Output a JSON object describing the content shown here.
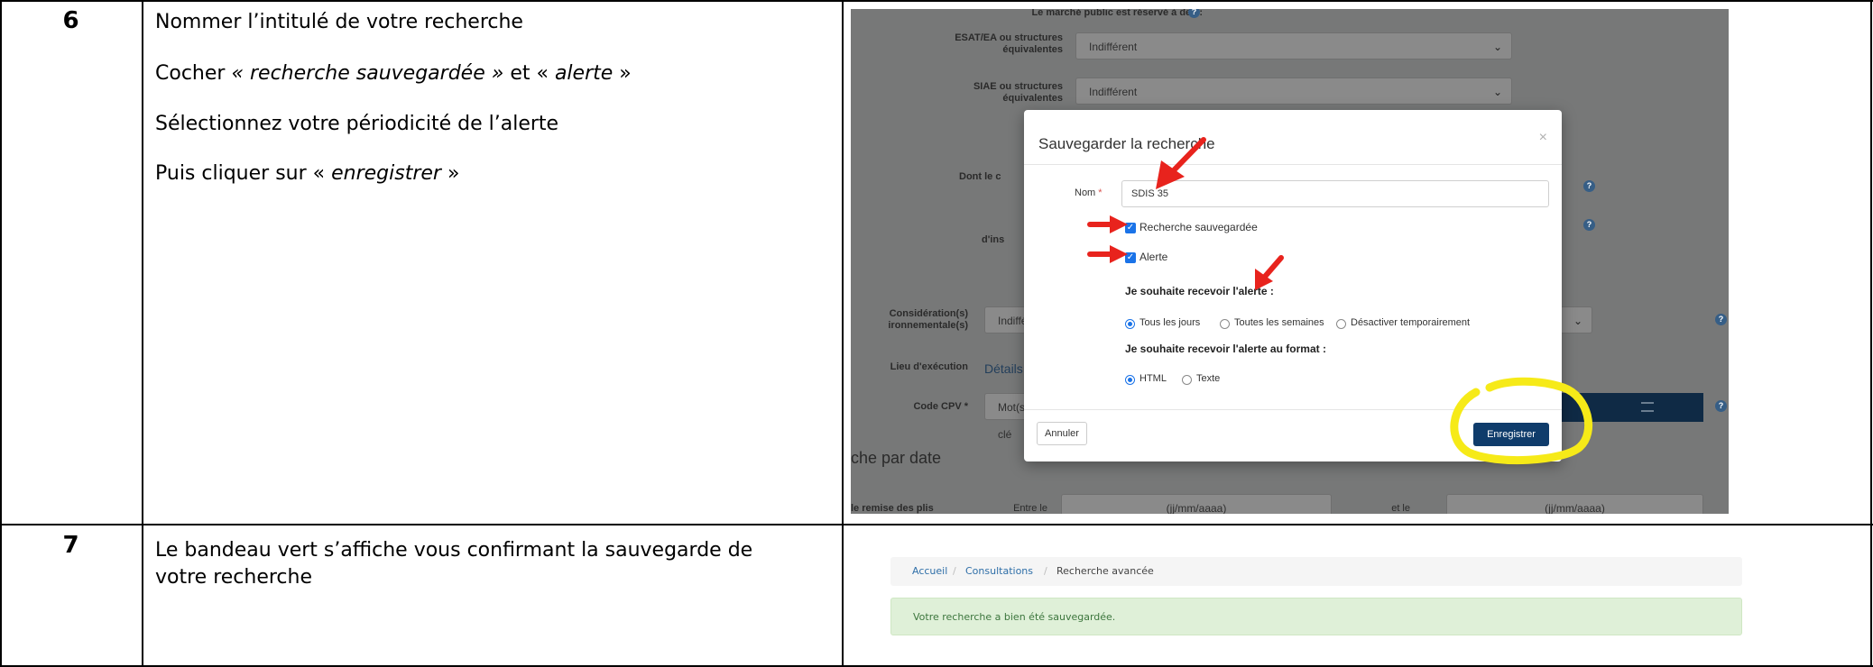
{
  "steps": [
    {
      "number": "6",
      "line1": "Nommer l’intitulé de votre recherche",
      "line2_prefix": "Cocher ",
      "line2_item1": "« recherche sauvegardée »",
      "line2_mid": " et « ",
      "line2_item2": "alerte",
      "line2_suffix": " »",
      "line3": "Sélectionnez votre périodicité de l’alerte",
      "line4_prefix": "Puis cliquer sur « ",
      "line4_item": "enregistrer",
      "line4_suffix": " »"
    },
    {
      "number": "7",
      "line1": "Le bandeau vert s’affiche vous confirmant la sauvegarde de",
      "line2": "votre recherche"
    }
  ],
  "form_background": {
    "reserved_label": "Le marché public est réservé à des :",
    "esat_label_1": "ESAT/EA ou structures",
    "esat_label_2": "équivalentes",
    "esat_value": "Indifférent",
    "siae_label_1": "SIAE ou structures",
    "siae_label_2": "équivalentes",
    "siae_value": "Indifférent",
    "dont_le_label": "Dont le c",
    "d_ins_label": "d'ins",
    "consideration_label_1": "Considération(s)",
    "consideration_label_2": "ironnementale(s)",
    "consideration_value": "Indifféren",
    "lieu_label": "Lieu d'exécution",
    "details_label": "Détails",
    "cpv_label": "Code CPV *",
    "cpv_placeholder": "Mot(s) clé",
    "section_heading": "che par date",
    "remise_label": "le remise des plis",
    "entre_label": "Entre le",
    "date_placeholder_1": "(jj/mm/aaaa)",
    "et_le_label": "et le",
    "date_placeholder_2": "(jj/mm/aaaa)",
    "help_glyph": "?"
  },
  "modal": {
    "title": "Sauvegarder la recherche",
    "close": "×",
    "nom_label": "Nom",
    "required_mark": "*",
    "nom_value": "SDIS 35",
    "checkbox_saved": "Recherche sauvegardée",
    "checkbox_alert": "Alerte",
    "frequency_heading": "Je souhaite recevoir l'alerte :",
    "frequency_options": [
      "Tous les jours",
      "Toutes les semaines",
      "Désactiver temporairement"
    ],
    "format_heading": "Je souhaite recevoir l'alerte au format :",
    "format_options": [
      "HTML",
      "Texte"
    ],
    "cancel_button": "Annuler",
    "save_button": "Enregistrer"
  },
  "confirmation": {
    "breadcrumb": [
      "Accueil",
      "Consultations",
      "Recherche avancée"
    ],
    "separator": "/",
    "message": "Votre recherche a bien été sauvegardée."
  },
  "colors": {
    "annotation_arrow": "#e8231d",
    "annotation_highlight": "#f6ea18",
    "primary_button": "#0f3c6b",
    "checkbox": "#1a73e8",
    "success_bg": "#dff0d8",
    "success_text": "#3c763d",
    "link": "#2f6fa8"
  }
}
